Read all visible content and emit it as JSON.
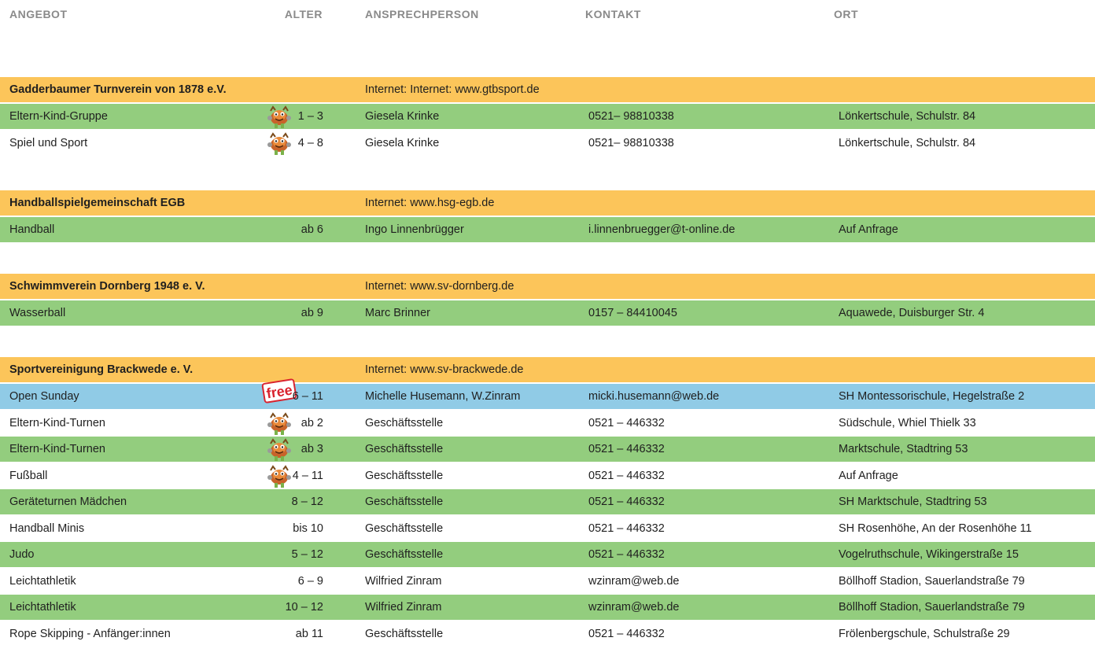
{
  "header": {
    "angebot": "ANGEBOT",
    "alter": "ALTER",
    "ansprechperson": "ANSPRECHPERSON",
    "kontakt": "KONTAKT",
    "ort": "ORT"
  },
  "badge_free": "free",
  "colors": {
    "org_row": "#fcc55a",
    "green_row": "#93cd7e",
    "blue_row": "#90cbe6",
    "header_text": "#8a8a8a",
    "free_badge": "#d9232e"
  },
  "groups": [
    {
      "name": "Gadderbaumer Turnverein von 1878 e.V.",
      "internet": "Internet: Internet: www.gtbsport.de",
      "rows": [
        {
          "angebot": "Eltern-Kind-Gruppe",
          "alter": "1 – 3",
          "person": "Giesela Krinke",
          "kontakt": "0521– 98810338",
          "ort": "Lönkertschule, Schulstr. 84",
          "icon": "mascot"
        },
        {
          "angebot": "Spiel und Sport",
          "alter": "4 – 8",
          "person": "Giesela Krinke",
          "kontakt": "0521– 98810338",
          "ort": "Lönkertschule, Schulstr. 84",
          "icon": "mascot"
        }
      ]
    },
    {
      "name": "Handballspielgemeinschaft EGB",
      "internet": "Internet: www.hsg-egb.de",
      "rows": [
        {
          "angebot": "Handball",
          "alter": "ab 6",
          "person": "Ingo Linnenbrügger",
          "kontakt": "i.linnenbruegger@t-online.de",
          "ort": "Auf Anfrage"
        }
      ]
    },
    {
      "name": "Schwimmverein Dornberg 1948 e. V.",
      "internet": "Internet: www.sv-dornberg.de",
      "rows": [
        {
          "angebot": "Wasserball",
          "alter": "ab 9",
          "person": "Marc Brinner",
          "kontakt": "0157 – 84410045",
          "ort": "Aquawede,  Duisburger Str. 4"
        }
      ]
    },
    {
      "name": "Sportvereinigung Brackwede e. V.",
      "internet": "Internet: www.sv-brackwede.de",
      "rows": [
        {
          "angebot": "Open Sunday",
          "alter": "6 – 11",
          "person": "Michelle Husemann, W.Zinram",
          "kontakt": "micki.husemann@web.de",
          "ort": "SH Montessorischule, Hegelstraße 2",
          "icon": "free"
        },
        {
          "angebot": "Eltern-Kind-Turnen",
          "alter": "ab 2",
          "person": "Geschäftsstelle",
          "kontakt": "0521 – 446332",
          "ort": "Südschule, Whiel Thielk 33",
          "icon": "mascot"
        },
        {
          "angebot": "Eltern-Kind-Turnen",
          "alter": "ab 3",
          "person": "Geschäftsstelle",
          "kontakt": "0521 – 446332",
          "ort": "Marktschule, Stadtring 53",
          "icon": "mascot"
        },
        {
          "angebot": "Fußball",
          "alter": "4 – 11",
          "person": "Geschäftsstelle",
          "kontakt": "0521 – 446332",
          "ort": "Auf Anfrage",
          "icon": "mascot"
        },
        {
          "angebot": "Geräteturnen Mädchen",
          "alter": "8 – 12",
          "person": "Geschäftsstelle",
          "kontakt": "0521 – 446332",
          "ort": "SH Marktschule, Stadtring 53"
        },
        {
          "angebot": "Handball Minis",
          "alter": "bis 10",
          "person": "Geschäftsstelle",
          "kontakt": "0521 – 446332",
          "ort": "SH Rosenhöhe, An der Rosenhöhe 11"
        },
        {
          "angebot": "Judo",
          "alter": "5 – 12",
          "person": "Geschäftsstelle",
          "kontakt": "0521 – 446332",
          "ort": "Vogelruthschule, Wikingerstraße 15"
        },
        {
          "angebot": "Leichtathletik",
          "alter": "6 – 9",
          "person": "Wilfried Zinram",
          "kontakt": "wzinram@web.de",
          "ort": "Böllhoff Stadion, Sauerlandstraße 79"
        },
        {
          "angebot": "Leichtathletik",
          "alter": "10 – 12",
          "person": "Wilfried Zinram",
          "kontakt": "wzinram@web.de",
          "ort": "Böllhoff Stadion, Sauerlandstraße 79"
        },
        {
          "angebot": "Rope Skipping - Anfänger:innen",
          "alter": "ab 11",
          "person": "Geschäftsstelle",
          "kontakt": "0521 – 446332",
          "ort": "Frölenbergschule, Schulstraße 29"
        }
      ]
    }
  ]
}
